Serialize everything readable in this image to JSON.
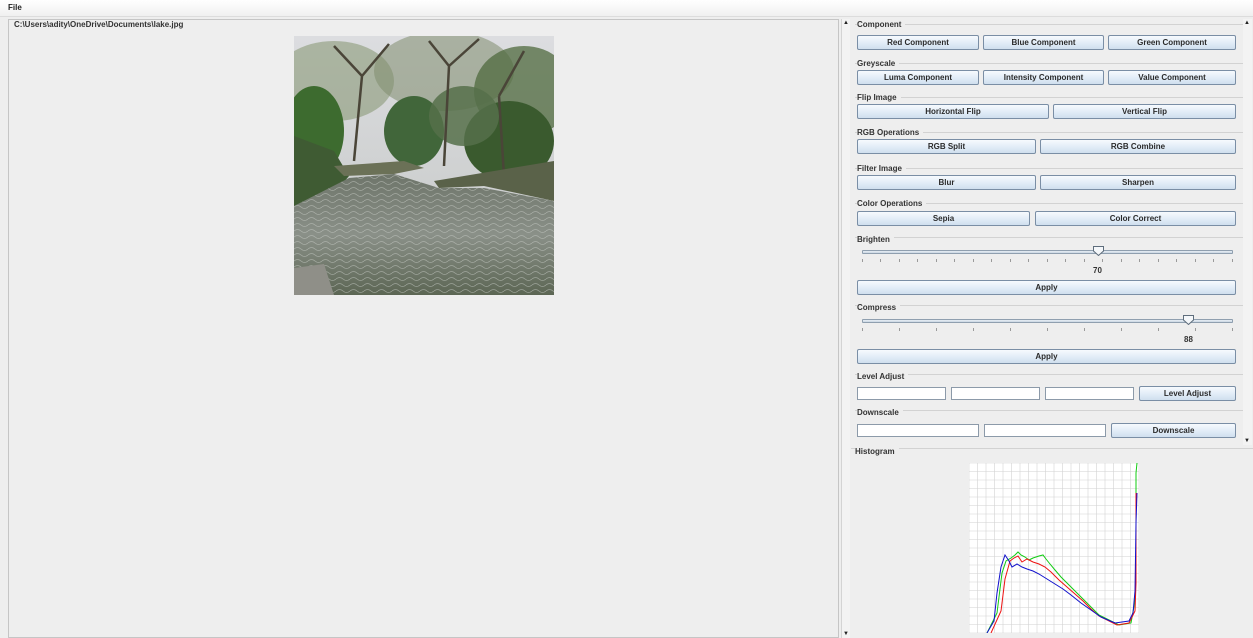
{
  "menu": {
    "file": "File"
  },
  "image_panel": {
    "path": "C:\\Users\\adity\\OneDrive\\Documents\\lake.jpg"
  },
  "component": {
    "title": "Component",
    "red": "Red Component",
    "blue": "Blue Component",
    "green": "Green Component"
  },
  "greyscale": {
    "title": "Greyscale",
    "luma": "Luma Component",
    "intensity": "Intensity Component",
    "value": "Value Component"
  },
  "flip": {
    "title": "Flip Image",
    "horizontal": "Horizontal Flip",
    "vertical": "Vertical Flip"
  },
  "rgb_ops": {
    "title": "RGB Operations",
    "split": "RGB Split",
    "combine": "RGB Combine"
  },
  "filter": {
    "title": "Filter Image",
    "blur": "Blur",
    "sharpen": "Sharpen"
  },
  "color_ops": {
    "title": "Color Operations",
    "sepia": "Sepia",
    "correct": "Color Correct"
  },
  "brighten": {
    "title": "Brighten",
    "value": "70",
    "apply": "Apply"
  },
  "compress": {
    "title": "Compress",
    "value": "88",
    "apply": "Apply"
  },
  "level_adjust": {
    "title": "Level Adjust",
    "black": "",
    "mid": "",
    "white": "",
    "button": "Level Adjust"
  },
  "downscale": {
    "title": "Downscale",
    "width": "",
    "height": "",
    "button": "Downscale"
  },
  "histogram": {
    "title": "Histogram",
    "colors": {
      "red": "#ee1111",
      "green": "#11cc11",
      "blue": "#1111cc"
    }
  }
}
